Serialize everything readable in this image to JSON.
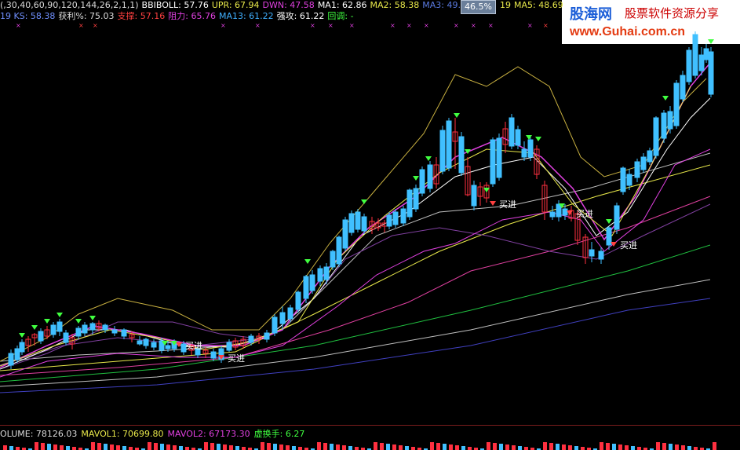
{
  "header_row1": [
    {
      "name": "params",
      "text": "(,30,40,60,90,120,144,26,2,1,1)",
      "color": "#dcdcdc"
    },
    {
      "name": "bbiboll",
      "text": "BBIBOLL: 57.76",
      "color": "#ffffff"
    },
    {
      "name": "upr",
      "text": "UPR: 67.94",
      "color": "#e8e84a"
    },
    {
      "name": "dwn",
      "text": "DWN: 47.58",
      "color": "#e040e0"
    },
    {
      "name": "ma1",
      "text": "MA1: 62.86",
      "color": "#ffffff"
    },
    {
      "name": "ma2",
      "text": "MA2: 58.38",
      "color": "#e8e84a"
    },
    {
      "name": "ma3",
      "text": "MA3: 49.69",
      "color": "#5a7ae0"
    }
  ],
  "badge": {
    "text": "46.5%"
  },
  "header_row1_tail": [
    {
      "name": "ma4-tail",
      "text": "19",
      "color": "#e8e84a"
    },
    {
      "name": "ma5",
      "text": "MA5: 48.69",
      "color": "#e8e84a"
    }
  ],
  "header_row2": [
    {
      "name": "ks",
      "text": "19  KS: 58.38",
      "color": "#7090ff"
    },
    {
      "name": "profit",
      "text": "获利%: 75.03",
      "color": "#dcdcdc"
    },
    {
      "name": "support",
      "text": "支撑: 57.16",
      "color": "#ff4040"
    },
    {
      "name": "resist",
      "text": "阻力: 65.76",
      "color": "#e040e0"
    },
    {
      "name": "ma13",
      "text": "MA13: 61.22",
      "color": "#40b0ff"
    },
    {
      "name": "attack",
      "text": "强攻: 61.22",
      "color": "#ffffff"
    },
    {
      "name": "pullback",
      "text": "回调: -",
      "color": "#40ff40"
    }
  ],
  "logo": {
    "cn": "股海网",
    "tag": "股票软件资源分享",
    "url": "www.Guhai.com.cn"
  },
  "buy_label": "买进",
  "volume_header": [
    {
      "name": "volume",
      "text": "OLUME: 78126.03",
      "color": "#dcdcdc"
    },
    {
      "name": "mavol1",
      "text": "MAVOL1: 70699.80",
      "color": "#e8e84a"
    },
    {
      "name": "mavol2",
      "text": "MAVOL2: 67173.30",
      "color": "#e040e0"
    },
    {
      "name": "turnover",
      "text": "虚换手: 6.27",
      "color": "#40ff40"
    }
  ],
  "colors": {
    "up": "#ff3040",
    "down": "#40c0ff",
    "bg": "#000000"
  }
}
